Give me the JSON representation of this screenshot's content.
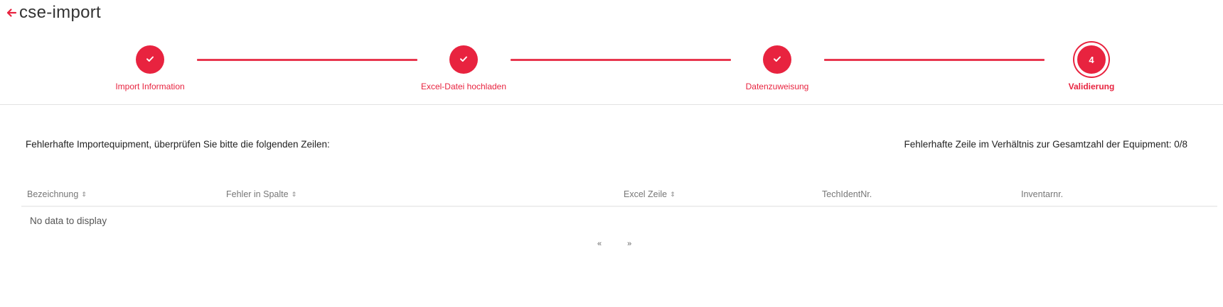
{
  "header": {
    "back_icon": "arrow-left-icon",
    "title": "cse-import"
  },
  "colors": {
    "accent": "#e8233f",
    "line": "#e8374f",
    "divider": "#e2e2e2"
  },
  "stepper": {
    "steps": [
      {
        "label": "Import Information",
        "state": "done",
        "icon": "check-icon"
      },
      {
        "label": "Excel-Datei hochladen",
        "state": "done",
        "icon": "check-icon"
      },
      {
        "label": "Datenzuweisung",
        "state": "done",
        "icon": "check-icon"
      },
      {
        "label": "Validierung",
        "state": "active",
        "number": "4"
      }
    ]
  },
  "info": {
    "left": "Fehlerhafte Importequipment, überprüfen Sie bitte die folgenden Zeilen:",
    "right": "Fehlerhafte Zeile im Verhältnis zur Gesamtzahl der Equipment: 0/8"
  },
  "table": {
    "columns": [
      {
        "label": "Bezeichnung",
        "sortable": true
      },
      {
        "label": "Fehler in Spalte",
        "sortable": true
      },
      {
        "label": "Excel Zeile",
        "sortable": true
      },
      {
        "label": "TechIdentNr.",
        "sortable": false
      },
      {
        "label": "Inventarnr.",
        "sortable": false
      }
    ],
    "empty_message": "No data to display"
  },
  "pager": {
    "prev": "«",
    "next": "»"
  }
}
